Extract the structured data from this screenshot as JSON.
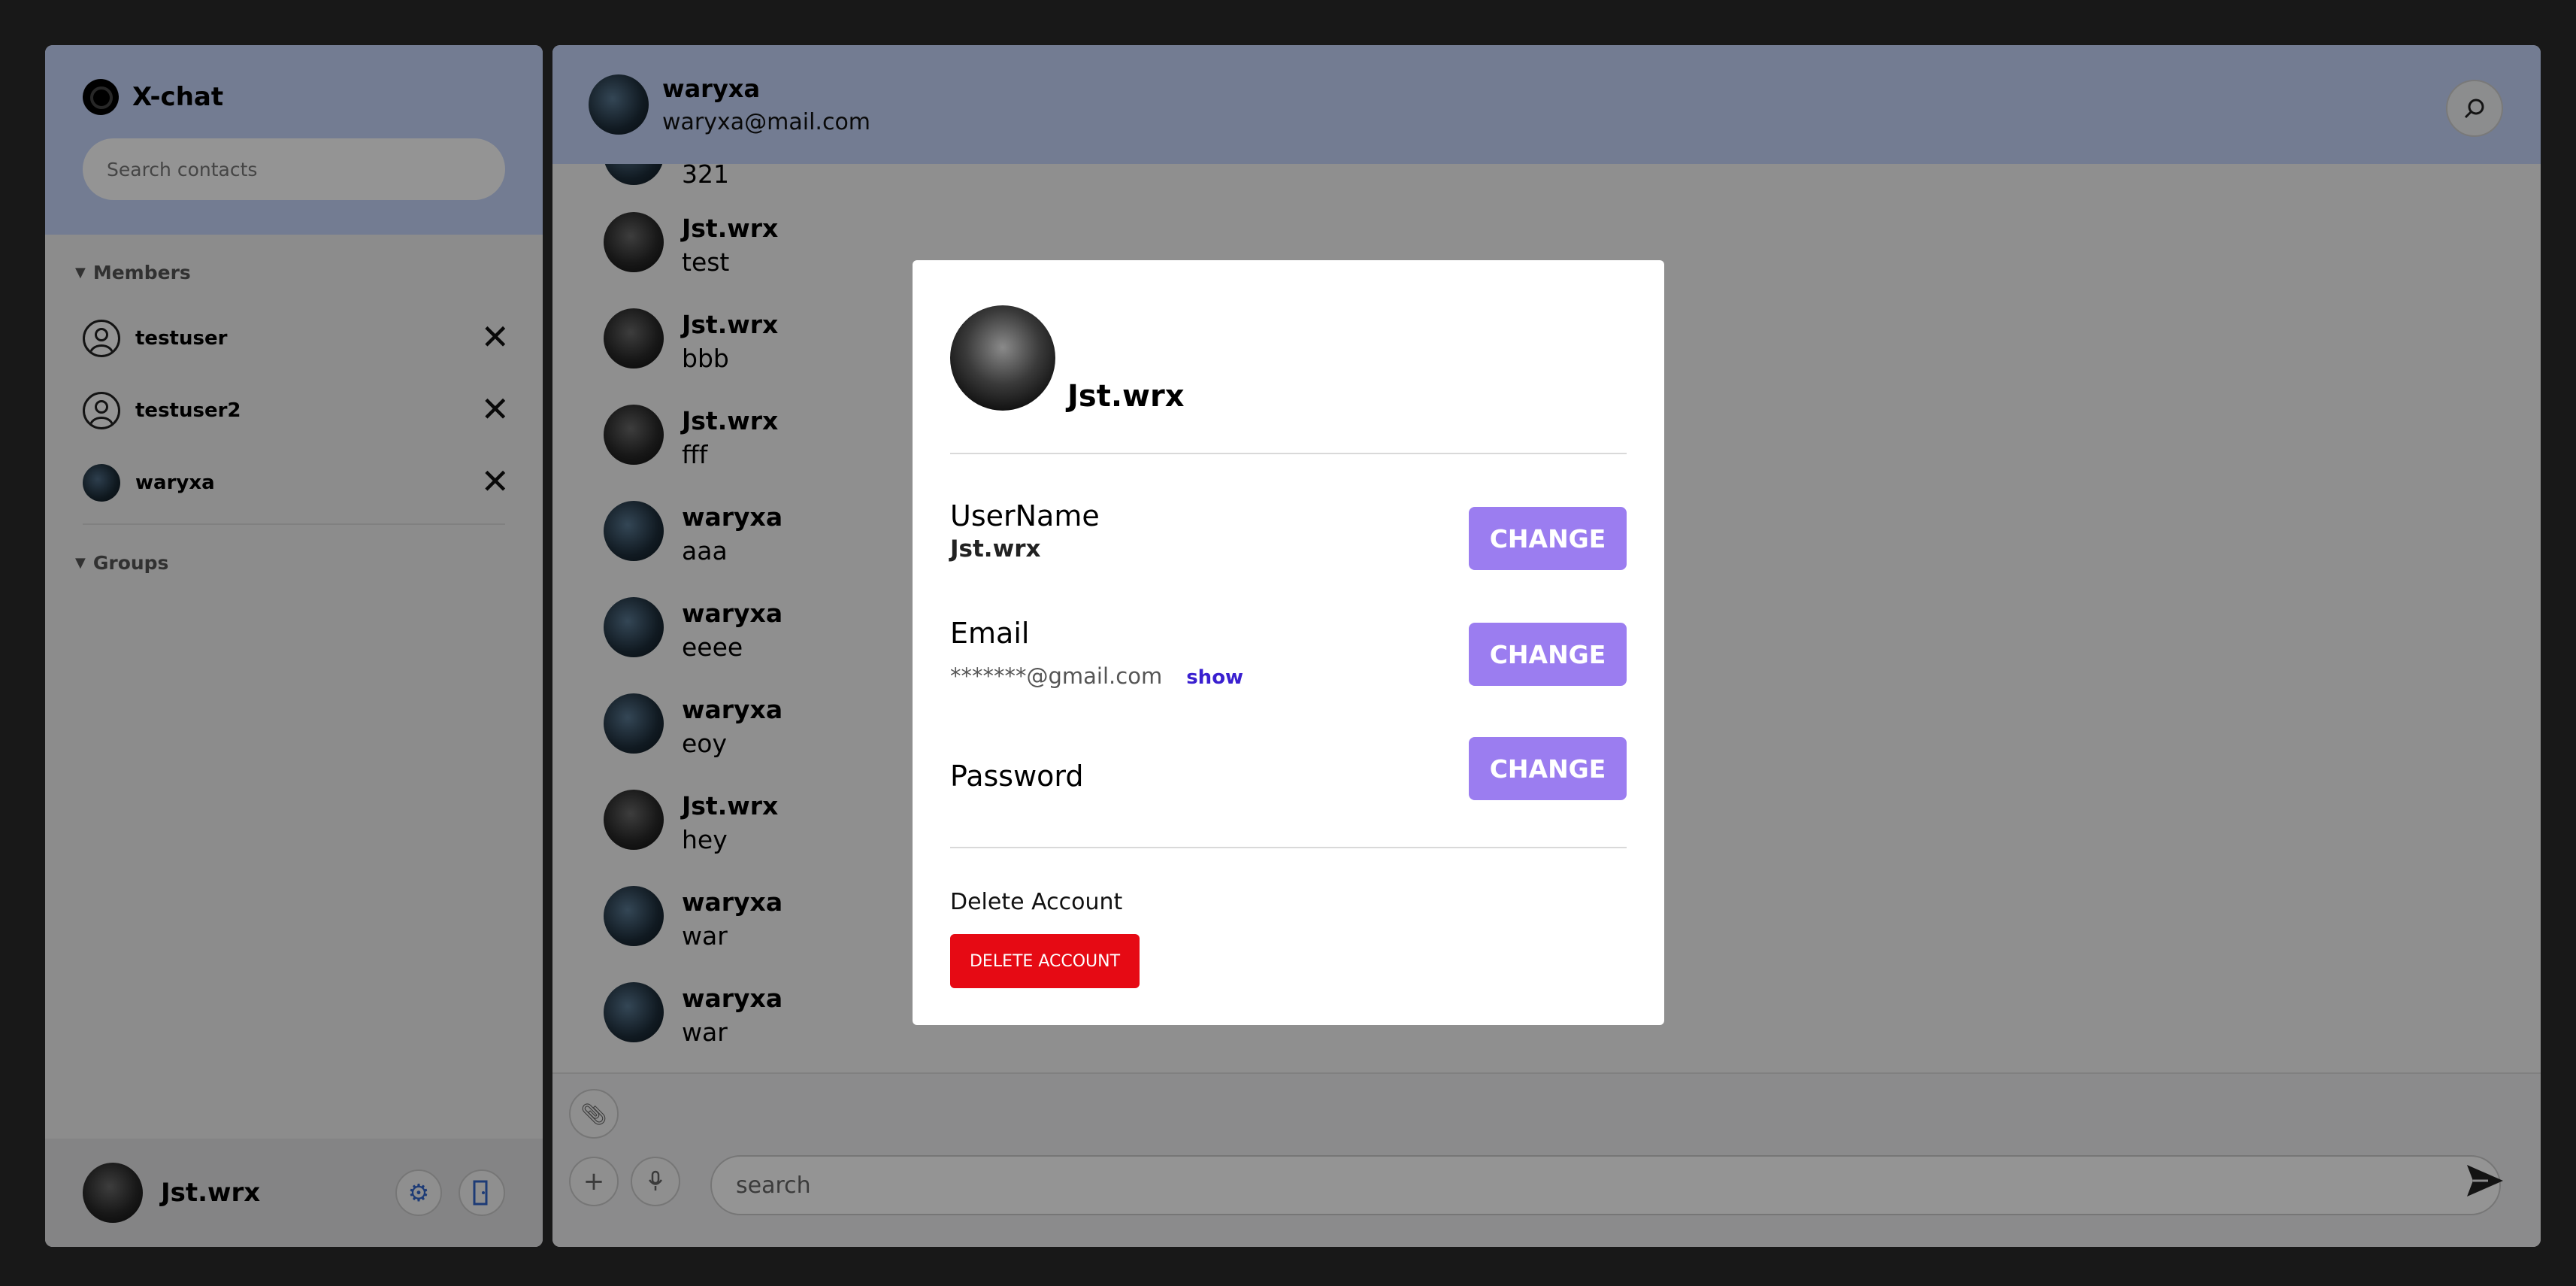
{
  "app": {
    "brand": "X-chat"
  },
  "sidebar": {
    "search_placeholder": "Search contacts",
    "members_title": "Members",
    "groups_title": "Groups",
    "members": [
      {
        "name": "testuser",
        "remove": "✕"
      },
      {
        "name": "testuser2",
        "remove": "✕"
      },
      {
        "name": "waryxa",
        "remove": "✕"
      }
    ],
    "current_user": "Jst.wrx",
    "settings_icon": "gear-icon",
    "logout_icon": "logout-icon"
  },
  "chat": {
    "contact_name": "waryxa",
    "contact_email": "waryxa@mail.com",
    "partial_text": "321",
    "messages": [
      {
        "author": "Jst.wrx",
        "text": "test"
      },
      {
        "author": "Jst.wrx",
        "text": "bbb"
      },
      {
        "author": "Jst.wrx",
        "text": "fff"
      },
      {
        "author": "waryxa",
        "text": "aaa"
      },
      {
        "author": "waryxa",
        "text": "eeee"
      },
      {
        "author": "waryxa",
        "text": "eoy"
      },
      {
        "author": "Jst.wrx",
        "text": "hey"
      },
      {
        "author": "waryxa",
        "text": "war"
      },
      {
        "author": "waryxa",
        "text": "war"
      }
    ],
    "input_placeholder": "search"
  },
  "modal": {
    "name": "Jst.wrx",
    "username_label": "UserName",
    "username_value": "Jst.wrx",
    "email_label": "Email",
    "email_masked": "*******@gmail.com",
    "show_label": "show",
    "password_label": "Password",
    "change_label": "CHANGE",
    "delete_label": "Delete Account",
    "delete_button": "DELETE ACCOUNT"
  },
  "colors": {
    "header_bg": "#c6d6fb",
    "change_button": "#9b7df0",
    "delete_button": "#e60a14",
    "show_link": "#3a20d0"
  }
}
